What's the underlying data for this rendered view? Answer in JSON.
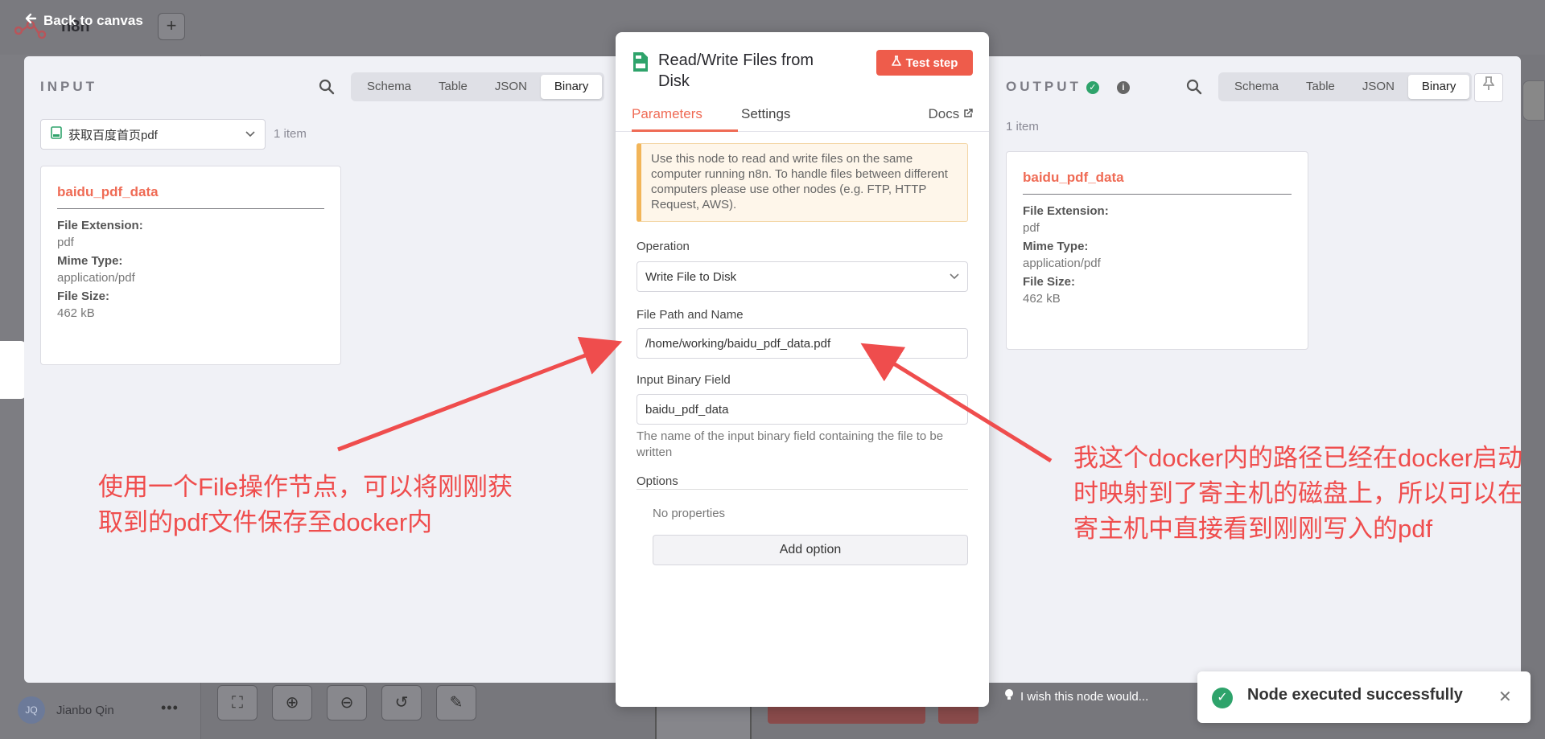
{
  "background": {
    "back_link": "Back to canvas",
    "logo_text": "n8n",
    "plus": "+",
    "user_initials": "JQ",
    "user_name": "Jianbo Qin",
    "user_menu": "•••"
  },
  "input": {
    "title": "INPUT",
    "views": [
      "Schema",
      "Table",
      "JSON",
      "Binary"
    ],
    "active_view": "Binary",
    "run_select": "获取百度首页pdf",
    "items": "1 item",
    "card": {
      "name": "baidu_pdf_data",
      "ext_label": "File Extension:",
      "ext_value": "pdf",
      "mime_label": "Mime Type:",
      "mime_value": "application/pdf",
      "size_label": "File Size:",
      "size_value": "462 kB"
    }
  },
  "node": {
    "title": "Read/Write Files from Disk",
    "test_button": "Test step",
    "tab_parameters": "Parameters",
    "tab_settings": "Settings",
    "docs": "Docs",
    "notice": "Use this node to read and write files on the same computer running n8n. To handle files between different computers please use other nodes (e.g. FTP, HTTP Request, AWS).",
    "operation_label": "Operation",
    "operation_value": "Write File to Disk",
    "path_label": "File Path and Name",
    "path_value": "/home/working/baidu_pdf_data.pdf",
    "binary_label": "Input Binary Field",
    "binary_value": "baidu_pdf_data",
    "binary_hint": "The name of the input binary field containing the file to be written",
    "options_label": "Options",
    "no_properties": "No properties",
    "add_option": "Add option"
  },
  "output": {
    "title": "OUTPUT",
    "views": [
      "Schema",
      "Table",
      "JSON",
      "Binary"
    ],
    "active_view": "Binary",
    "items": "1 item",
    "card": {
      "name": "baidu_pdf_data",
      "ext_label": "File Extension:",
      "ext_value": "pdf",
      "mime_label": "Mime Type:",
      "mime_value": "application/pdf",
      "size_label": "File Size:",
      "size_value": "462 kB"
    }
  },
  "wish": "I wish this node would...",
  "toast": {
    "message": "Node executed successfully"
  },
  "annotations": {
    "left_note": "使用一个File操作节点，可以将刚刚获取到的pdf文件保存至docker内",
    "right_note": "我这个docker内的路径已经在docker启动时映射到了寄主机的磁盘上，所以可以在寄主机中直接看到刚刚写入的pdf"
  },
  "colors": {
    "accent": "#ef6b55",
    "success": "#2ea36b",
    "annotation": "#ef4d4d",
    "notice_border": "#f2b559"
  },
  "icons": {
    "back": "arrow-left-icon",
    "search": "search-icon",
    "pin": "pin-icon",
    "flask": "flask-icon",
    "external": "external-link-icon",
    "bulb": "lightbulb-icon",
    "check": "check-circle-icon",
    "close": "close-icon"
  }
}
